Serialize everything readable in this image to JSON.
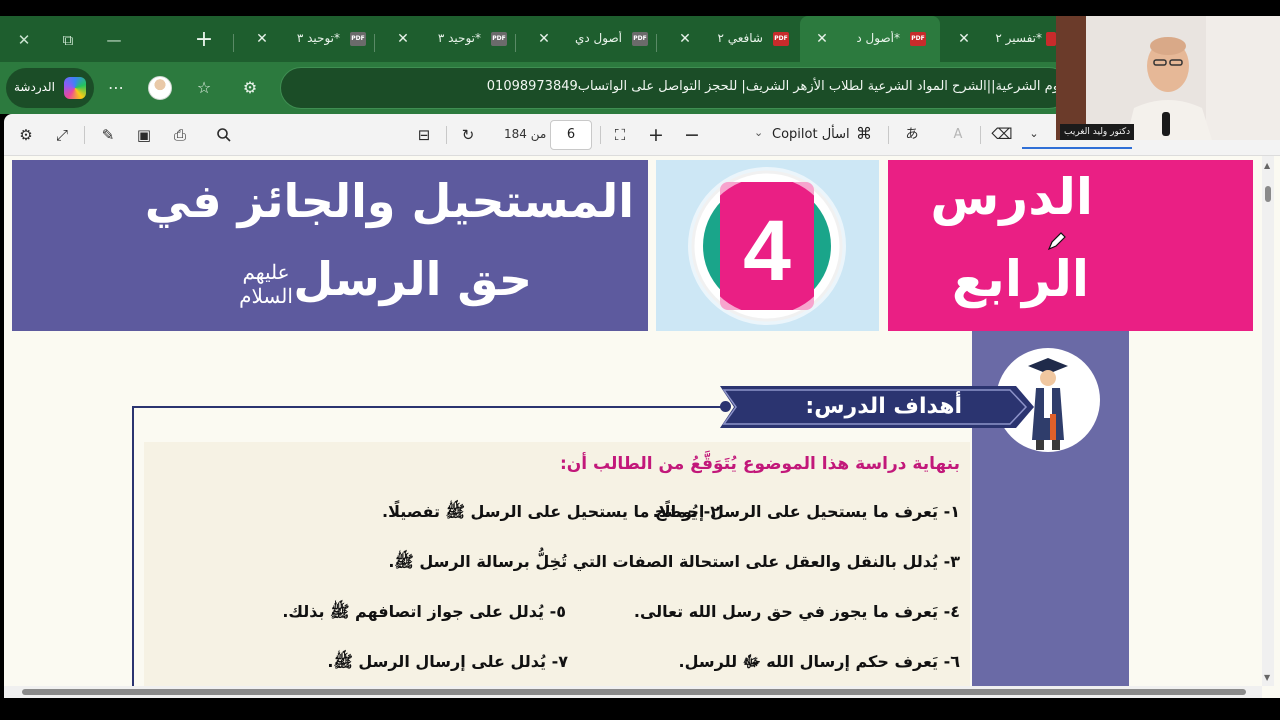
{
  "browser": {
    "tabs": [
      {
        "label": "*توحيد ٣",
        "active": false,
        "dim": true
      },
      {
        "label": "*توحيد ٣",
        "active": false,
        "dim": true
      },
      {
        "label": "أصول دي",
        "active": false,
        "dim": true
      },
      {
        "label": "شافعي ٢",
        "active": false,
        "dim": false
      },
      {
        "label": "*أصول د",
        "active": true,
        "dim": false
      },
      {
        "label": "*تفسير ٢",
        "active": false,
        "dim": false
      }
    ],
    "new_tab_icon": "plus-icon",
    "window_controls": [
      "close-icon",
      "restore-icon",
      "minimize-icon"
    ],
    "chat_label": "الدردشة",
    "address_text": "وم الشرعية||الشرح المواد الشرعية لطلاب الأزهر الشريف| للحجز التواصل على الواتساب01098973849"
  },
  "pdf_toolbar": {
    "page_current": "6",
    "page_total_text": "من 184",
    "ask_copilot": "اسأل Copilot",
    "icons": [
      "settings-icon",
      "expand-icon",
      "annotate-icon",
      "save-icon",
      "print-icon",
      "search-icon",
      "page-view-icon",
      "rotate-icon",
      "fit-page-icon",
      "zoom-in-icon",
      "zoom-out-icon",
      "copilot-icon",
      "read-aloud-icon",
      "text-icon",
      "eraser-icon",
      "chevron-down-icon"
    ]
  },
  "lesson": {
    "label_line1": "الدرس",
    "label_line2": "الرابع",
    "number": "4",
    "title_line1": "المستحيل والجائز في",
    "title_line2": "حق الرسل",
    "salutation": "عليهم السلام",
    "objectives_title": "أهداف الدرس:",
    "intro": "بنهاية دراسة هذا الموضوع يُتَوَقَّعُ من الطالب أن:",
    "objectives": [
      "١- يَعرف ما يستحيل على الرسل إجمالًا.",
      "٢- يُوضح ما يستحيل على الرسل ﷺ تفصيلًا.",
      "٣- يُدلل بالنقل والعقل على استحالة الصفات التي تُخِلُّ برسالة الرسل ﷺ.",
      "٤- يَعرف ما يجوز في حق رسل الله تعالى.",
      "٥- يُدلل على جواز اتصافهم ﷺ بذلك.",
      "٦- يَعرف حكم إرسال الله ﷻ للرسل.",
      "٧- يُدلل على إرسال الرسل ﷺ."
    ]
  },
  "webcam": {
    "caption": "دكتور وليد الغريب"
  },
  "colors": {
    "tab_strip": "#1e5e2e",
    "nav_row": "#2c7a3e",
    "title_band": "#5d5a9e",
    "lesson_box": "#ea1f84",
    "badge_bg": "#cde7f5",
    "badge_ring": "#1aa58a",
    "objectives_header": "#2b3470",
    "intro_text": "#c2187a"
  }
}
